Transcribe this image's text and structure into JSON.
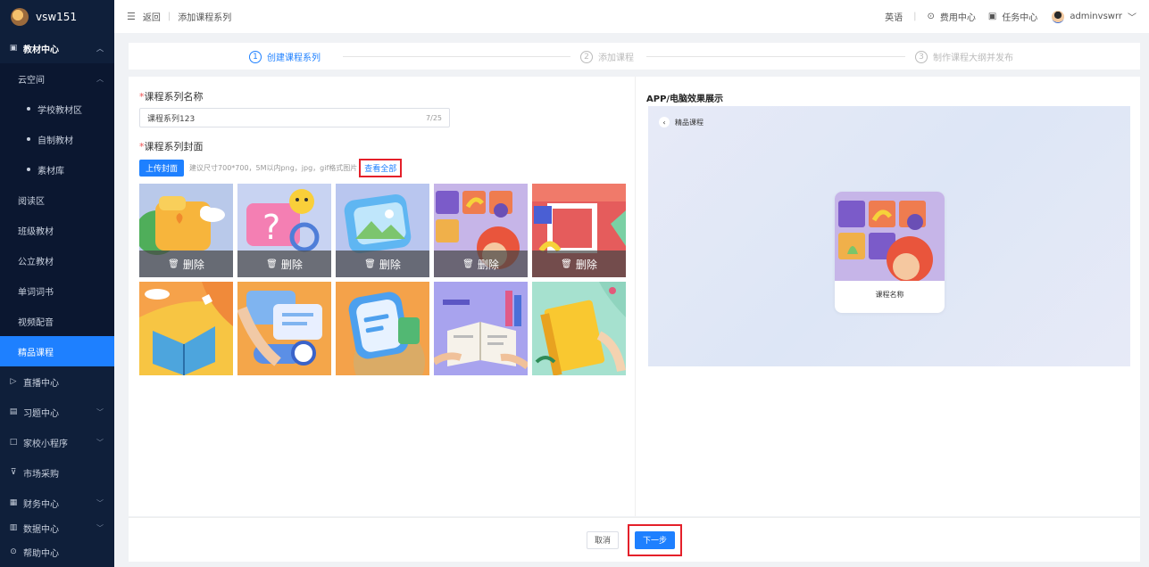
{
  "sidebar": {
    "brand": "vsw151",
    "items": [
      {
        "label": "教材中心",
        "icon": "book-icon",
        "chevron": "^"
      },
      {
        "label": "云空间",
        "chevron": "^"
      },
      {
        "label": "学校教材区"
      },
      {
        "label": "自制教材"
      },
      {
        "label": "素材库"
      },
      {
        "label": "阅读区"
      },
      {
        "label": "班级教材"
      },
      {
        "label": "公立教材"
      },
      {
        "label": "单词词书"
      },
      {
        "label": "视频配音"
      },
      {
        "label": "精品课程"
      },
      {
        "label": "直播中心",
        "icon": "live-icon"
      },
      {
        "label": "习题中心",
        "icon": "exercise-icon",
        "chevron": "v"
      },
      {
        "label": "家校小程序",
        "icon": "miniapp-icon",
        "chevron": "v"
      },
      {
        "label": "市场采购",
        "icon": "cart-icon"
      },
      {
        "label": "财务中心",
        "icon": "finance-icon",
        "chevron": "v"
      },
      {
        "label": "数据中心",
        "icon": "data-icon",
        "chevron": "v"
      },
      {
        "label": "帮助中心",
        "icon": "help-icon"
      }
    ]
  },
  "topbar": {
    "back": "返回",
    "page": "添加课程系列",
    "lang": "英语",
    "fee": "费用中心",
    "task": "任务中心",
    "user": "adminvswrr"
  },
  "steps": [
    {
      "num": "1",
      "label": "创建课程系列"
    },
    {
      "num": "2",
      "label": "添加课程"
    },
    {
      "num": "3",
      "label": "制作课程大纲并发布"
    }
  ],
  "form": {
    "name_label": "课程系列名称",
    "name_value": "课程系列123",
    "name_count": "7/25",
    "cover_label": "课程系列封面",
    "upload_btn": "上传封面",
    "upload_hint": "建议尺寸700*700，5M以内png，jpg，gif格式图片",
    "view_all": "查看全部",
    "delete_label": "删除"
  },
  "preview": {
    "title": "APP/电脑效果展示",
    "back_label": "精品课程",
    "card_name": "课程名称"
  },
  "footer": {
    "cancel": "取消",
    "next": "下一步"
  }
}
